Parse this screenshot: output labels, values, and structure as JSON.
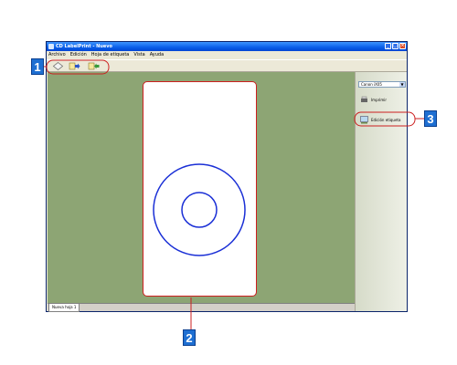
{
  "window": {
    "title": "CD LabelPrint - Nuevo"
  },
  "menu": [
    "Archivo",
    "Edición",
    "Hoja de etiqueta",
    "Vista",
    "Ayuda"
  ],
  "toolbar": {
    "buttons": [
      "new-label-icon",
      "import-icon",
      "export-icon"
    ]
  },
  "sheet_tab": "Nueva hoja 1",
  "side_panel": {
    "printer": "Canon iX05",
    "print_label": "Imprimir",
    "edit_label": "Edición etiqueta"
  },
  "callouts": [
    "1",
    "2",
    "3"
  ],
  "colors": {
    "workspace": "#8da574",
    "callout": "#1e6fd2",
    "highlight": "#cc1f1f",
    "disc_outline": "#1a2fd6"
  }
}
